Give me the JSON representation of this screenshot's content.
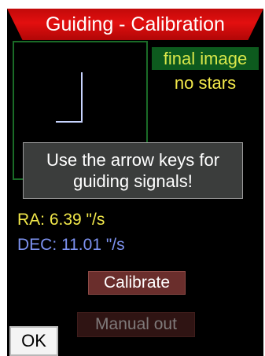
{
  "header": {
    "title": "Guiding - Calibration"
  },
  "status": {
    "image_state": "final image",
    "star_state": "no stars"
  },
  "message": {
    "line1": "Use the arrow keys for",
    "line2": "guiding signals!"
  },
  "readouts": {
    "ra": "RA: 6.39 \"/s",
    "dec": "DEC: 11.01 \"/s"
  },
  "buttons": {
    "calibrate": "Calibrate",
    "manual_out": "Manual out",
    "ok": "OK"
  },
  "colors": {
    "title_bar": "#e30f0f",
    "frame_border": "#1a6b27",
    "status_highlight": "#0d5a1e",
    "ra_text": "#f2e84a",
    "dec_text": "#7d92f0",
    "calibrate_button": "#6a2e2c",
    "manual_out_button_disabled": "#2f1413",
    "guide_trace": "#c8d4ff"
  }
}
